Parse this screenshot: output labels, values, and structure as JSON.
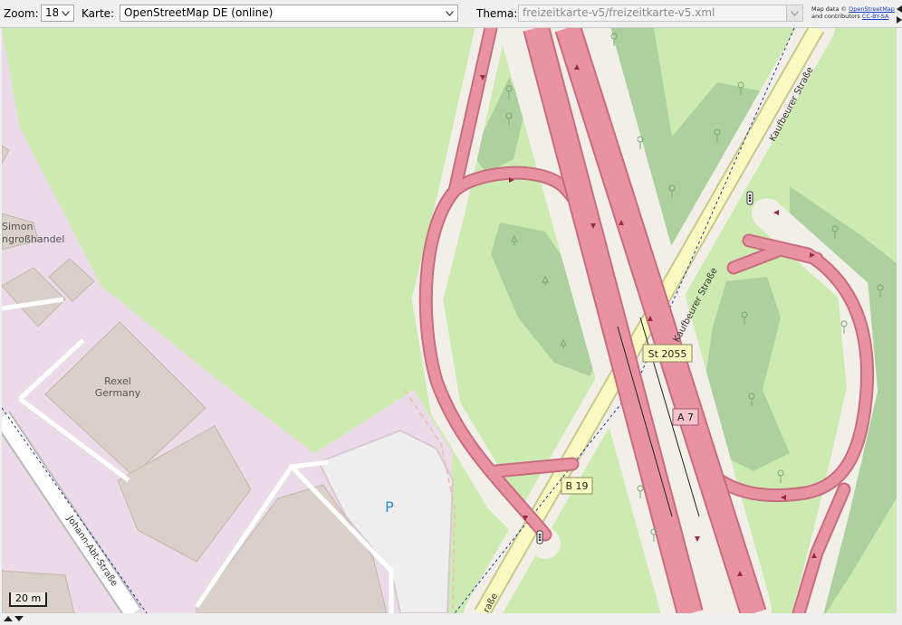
{
  "toolbar": {
    "zoom_label": "Zoom:",
    "zoom_value": "18",
    "map_label": "Karte:",
    "map_value": "OpenStreetMap DE (online)",
    "theme_label": "Thema:",
    "theme_value": "freizeitkarte-v5/freizeitkarte-v5.xml",
    "attribution_prefix": "Map data ©",
    "attribution_osm": "OpenStreetMap",
    "attribution_mid": "and contributors",
    "attribution_license": "CC-BY-SA"
  },
  "map": {
    "labels": {
      "simon_line1": "Simon",
      "simon_line2": "ngroßhandel",
      "rexel_line1": "Rexel",
      "rexel_line2": "Germany",
      "parking": "P",
      "kaufbeurer_1": "Kaufbeurer Straße",
      "kaufbeurer_2": "Kaufbeurer Straße",
      "johann": "Johann-Abt-Straße",
      "strasse_fragment": "raße"
    },
    "shields": {
      "st2055": "St 2055",
      "a7": "A 7",
      "b19": "B 19"
    },
    "scale": "20 m"
  },
  "colors": {
    "landuse_grass": "#cdebb0",
    "forest": "#add19e",
    "industrial": "#ebdbe8",
    "building": "#d9d0c9",
    "motorway": "#e892a2",
    "trunk": "#f9fac0",
    "parking": "#eeeeee"
  }
}
